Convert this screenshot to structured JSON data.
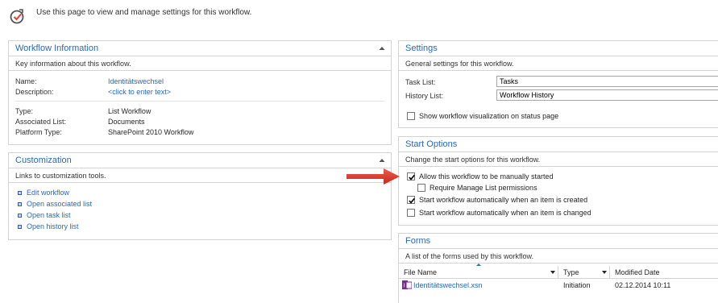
{
  "header": {
    "icon": "workflow-settings-icon",
    "text": "Use this page to view and manage settings for this workflow."
  },
  "workflow_info": {
    "title": "Workflow Information",
    "subtitle": "Key information about this workflow.",
    "fields": [
      {
        "label": "Name:",
        "value": "Identitätswechsel"
      },
      {
        "label": "Description:",
        "value": "<click to enter text>"
      },
      {
        "label": "Type:",
        "value": "List Workflow"
      },
      {
        "label": "Associated List:",
        "value": "Documents"
      },
      {
        "label": "Platform Type:",
        "value": "SharePoint 2010 Workflow"
      }
    ]
  },
  "customization": {
    "title": "Customization",
    "subtitle": "Links to customization tools.",
    "links": [
      "Edit workflow",
      "Open associated list",
      "Open task list",
      "Open history list"
    ]
  },
  "settings": {
    "title": "Settings",
    "subtitle": "General settings for this workflow.",
    "task_list_label": "Task List:",
    "task_list_value": "Tasks",
    "history_list_label": "History List:",
    "history_list_value": "Workflow History",
    "show_visualization_label": "Show workflow visualization on status page",
    "show_visualization_checked": false
  },
  "start_options": {
    "title": "Start Options",
    "subtitle": "Change the start options for this workflow.",
    "options": [
      {
        "label": "Allow this workflow to be manually started",
        "checked": true
      },
      {
        "label": "Require Manage List permissions",
        "checked": false
      },
      {
        "label": "Start workflow automatically when an item is created",
        "checked": true
      },
      {
        "label": "Start workflow automatically when an item is changed",
        "checked": false
      }
    ]
  },
  "forms": {
    "title": "Forms",
    "subtitle": "A list of the forms used by this workflow.",
    "columns": [
      "File Name",
      "Type",
      "Modified Date"
    ],
    "rows": [
      {
        "file_name": "Identitätswechsel.xsn",
        "type": "Initiation",
        "modified": "02.12.2014 10:11"
      }
    ]
  },
  "colors": {
    "accent": "#2a6ab4",
    "annotation_arrow": "#e0352b"
  }
}
